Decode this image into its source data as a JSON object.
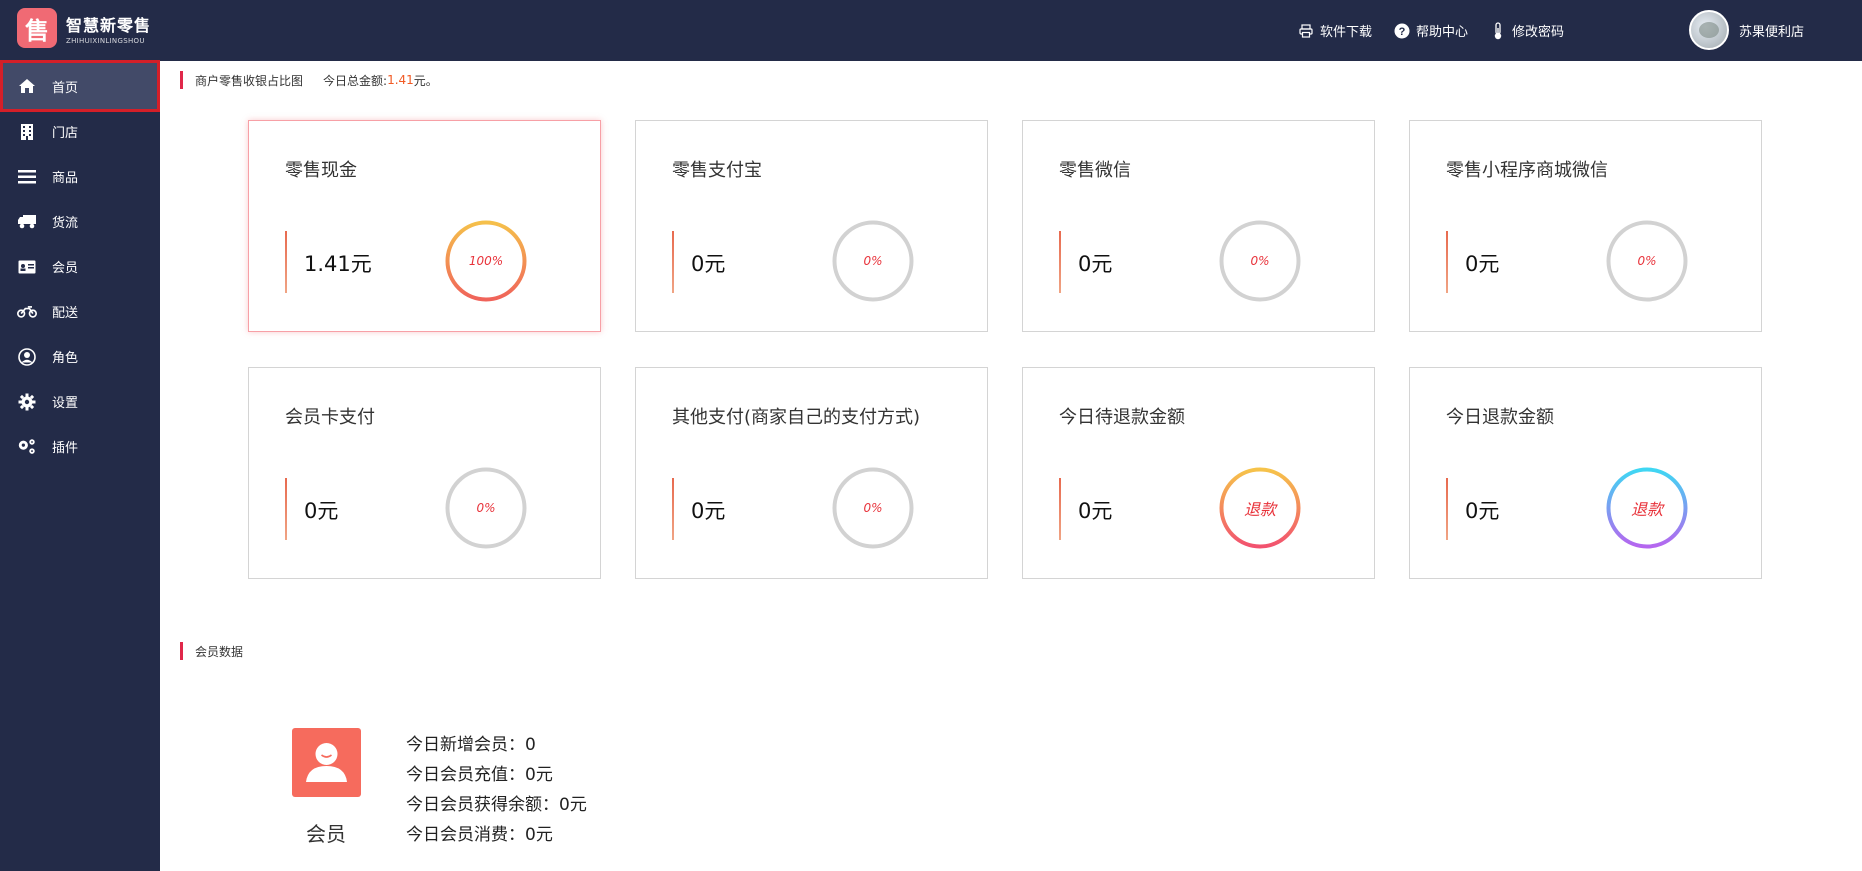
{
  "brand": {
    "logo_char": "售",
    "name": "智慧新零售",
    "sub": "ZHIHUIXINLINGSHOU"
  },
  "header": {
    "links": [
      {
        "label": "软件下载",
        "icon": "printer-icon"
      },
      {
        "label": "帮助中心",
        "icon": "help-icon"
      },
      {
        "label": "修改密码",
        "icon": "thermometer-icon"
      }
    ],
    "user_name": "苏果便利店"
  },
  "sidebar": {
    "items": [
      {
        "label": "首页",
        "icon": "home-icon",
        "active": true
      },
      {
        "label": "门店",
        "icon": "building-icon"
      },
      {
        "label": "商品",
        "icon": "list-icon"
      },
      {
        "label": "货流",
        "icon": "truck-icon"
      },
      {
        "label": "会员",
        "icon": "id-card-icon"
      },
      {
        "label": "配送",
        "icon": "motorcycle-icon"
      },
      {
        "label": "角色",
        "icon": "user-circle-icon"
      },
      {
        "label": "设置",
        "icon": "gear-icon"
      },
      {
        "label": "插件",
        "icon": "gears-icon"
      }
    ]
  },
  "summary": {
    "title": "商户零售收银占比图",
    "total_label": "今日总金额: ",
    "total_value": "1.41",
    "total_unit": "元。"
  },
  "cards": [
    {
      "title": "零售现金",
      "amount": "1.41元",
      "ring_text": "100%",
      "percent": 100,
      "active": true
    },
    {
      "title": "零售支付宝",
      "amount": "0元",
      "ring_text": "0%",
      "percent": 0
    },
    {
      "title": "零售微信",
      "amount": "0元",
      "ring_text": "0%",
      "percent": 0
    },
    {
      "title": "零售小程序商城微信",
      "amount": "0元",
      "ring_text": "0%",
      "percent": 0
    },
    {
      "title": "会员卡支付",
      "amount": "0元",
      "ring_text": "0%",
      "percent": 0
    },
    {
      "title": "其他支付(商家自己的支付方式)",
      "amount": "0元",
      "ring_text": "0%",
      "percent": 0
    },
    {
      "title": "今日待退款金额",
      "amount": "0元",
      "ring_text": "退款",
      "percent": 100,
      "ring_colors": [
        "#f6c34a",
        "#f2526f"
      ]
    },
    {
      "title": "今日退款金额",
      "amount": "0元",
      "ring_text": "退款",
      "percent": 100,
      "ring_colors": [
        "#3fd7f3",
        "#b566ef"
      ]
    }
  ],
  "member": {
    "section_title": "会员数据",
    "label": "会员",
    "stats": [
      "今日新增会员：0",
      "今日会员充值：0元",
      "今日会员获得余额：0元",
      "今日会员消费：0元"
    ]
  },
  "colors": {
    "header_bg": "#232b48",
    "accent": "#e0284a",
    "highlight": "#f15a24",
    "member_icon": "#f66b5d"
  }
}
